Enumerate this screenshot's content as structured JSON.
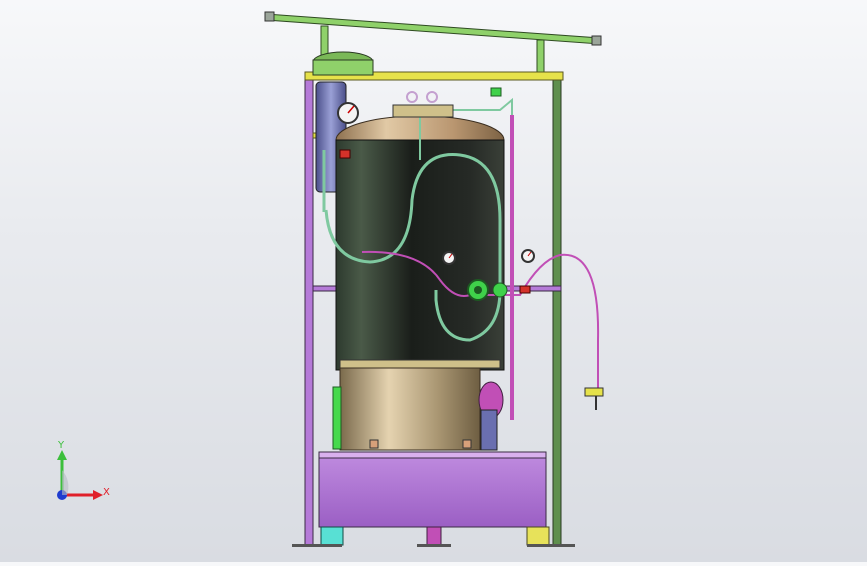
{
  "viewport": {
    "background_top": "#f7f8fa",
    "background_bottom": "#d9dce2"
  },
  "triad": {
    "x_label": "X",
    "y_label": "Y",
    "x_color": "#e0202a",
    "y_color": "#3cbf3c",
    "z_color": "#1f3ccf"
  },
  "model": {
    "colors": {
      "frame": "#5f8f4e",
      "frame_top": "#8fd16a",
      "rail": "#e6e24a",
      "vessel_dark": "#1c1f1c",
      "vessel_head": "#c9a77e",
      "skirt": "#b8a27a",
      "base": "#b57ad8",
      "feet": "#58e0d4",
      "foot_right": "#e7e25a",
      "pipe_green": "#7fc9a0",
      "pipe_magenta": "#c14fb6",
      "gauge": "#f4f4f4",
      "valve_red": "#d4322a",
      "valve_green": "#3fd14a",
      "blue_tank": "#6a6fb0"
    }
  }
}
